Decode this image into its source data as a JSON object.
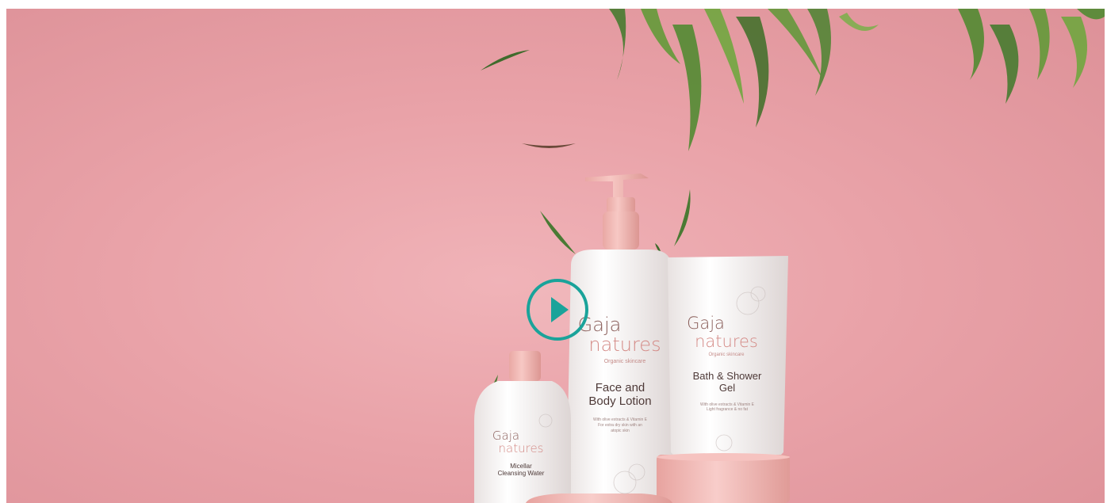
{
  "video": {
    "play_label": "Play video"
  },
  "products": {
    "lotion": {
      "brand_top": "Gaja",
      "brand_bottom": "natures",
      "tagline": "Organic skincare",
      "name_line1": "Face and",
      "name_line2": "Body Lotion",
      "desc_line1": "With olive extracts & Vitamin E",
      "desc_line2": "For extra dry skin with an",
      "desc_line3": "atopic skin"
    },
    "gel": {
      "brand_top": "Gaja",
      "brand_bottom": "natures",
      "tagline": "Organic skincare",
      "name_line1": "Bath & Shower",
      "name_line2": "Gel",
      "desc_line1": "With olive extracts & Vitamin E",
      "desc_line2": "Light fragrance & no fat"
    },
    "micellar": {
      "brand_top": "Gaja",
      "brand_bottom": "natures",
      "name_line1": "Micellar",
      "name_line2": "Cleansing Water"
    }
  },
  "colors": {
    "background": "#e9a2a8",
    "play_accent": "#1aa39a",
    "cap_pink": "#f2b9b5"
  }
}
